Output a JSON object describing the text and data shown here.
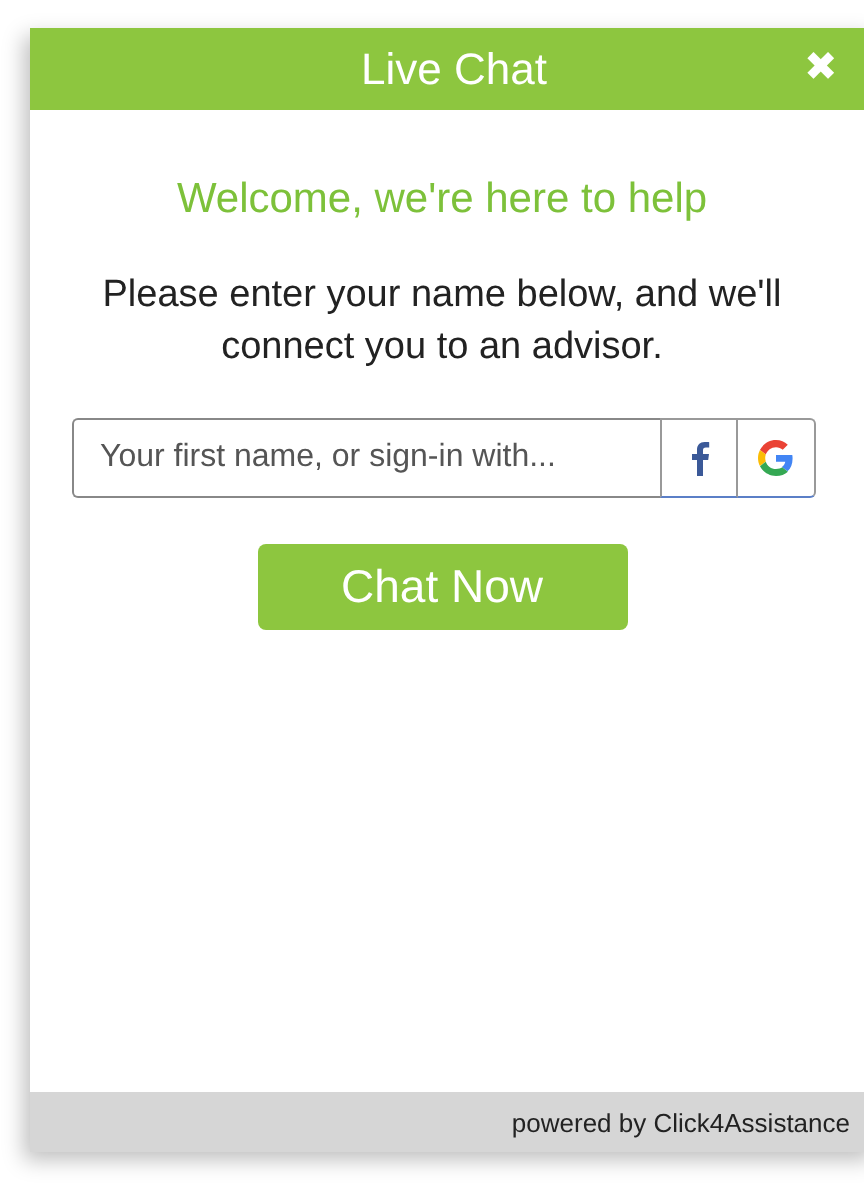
{
  "header": {
    "title": "Live Chat",
    "close": "✖"
  },
  "welcome": "Welcome, we're here to help",
  "instructions": "Please enter your name below, and we'll connect you to an advisor.",
  "name_field": {
    "placeholder": "Your first name, or sign-in with..."
  },
  "chat_button": "Chat Now",
  "footer": "powered by Click4Assistance"
}
